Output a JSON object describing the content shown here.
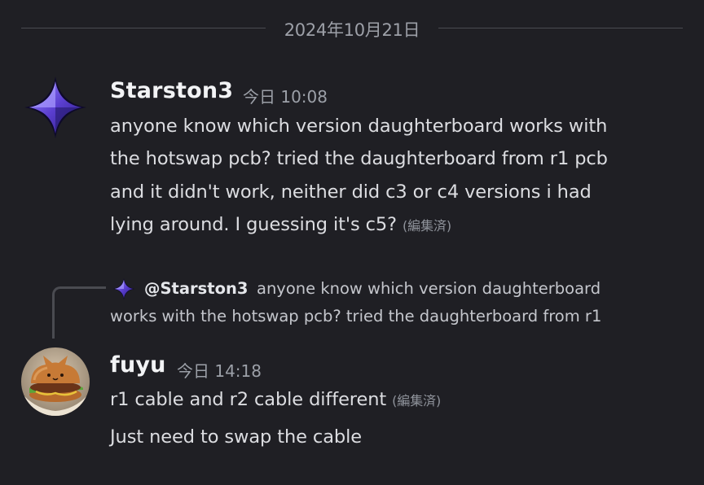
{
  "date_divider": "2024年10月21日",
  "messages": [
    {
      "username": "Starston3",
      "timestamp": "今日 10:08",
      "lines": [
        "anyone know which version daughterboard works with",
        "the hotswap pcb? tried the daughterboard from r1 pcb",
        "and it didn't work, neither did c3 or c4 versions i had",
        "lying around. I guessing it's c5?"
      ],
      "edited": "(編集済)",
      "avatar_icon": "four-point-star-icon"
    },
    {
      "reply": {
        "mention": "@Starston3",
        "preview_line1": "anyone know which version daughterboard",
        "preview_line2": "works with the hotswap pcb? tried the daughterboard from r1"
      },
      "username": "fuyu",
      "timestamp": "今日 14:18",
      "line1": "r1 cable and r2 cable different",
      "edited": "(編集済)",
      "line2": "Just need to swap the cable",
      "avatar_icon": "burger-photo-avatar"
    }
  ],
  "colors": {
    "background": "#1f1f24",
    "username": "#f2f3f5",
    "text": "#dcdde1",
    "muted": "#9ca0a8",
    "star_purple": "#6a4fd6"
  }
}
